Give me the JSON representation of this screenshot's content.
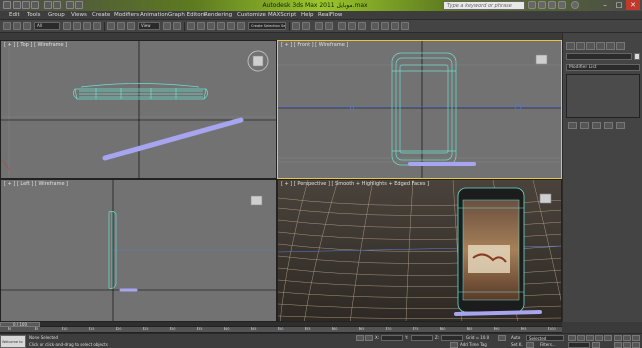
{
  "titlebar": {
    "title": "Autodesk 3ds Max 2011   موبايل.max",
    "search_placeholder": "Type a keyword or phrase",
    "window_controls": [
      "–",
      "□",
      "✕"
    ]
  },
  "menubar": {
    "items": [
      "Edit",
      "Tools",
      "Group",
      "Views",
      "Create",
      "Modifiers",
      "Animation",
      "Graph Editors",
      "Rendering",
      "Customize",
      "MAXScript",
      "Help",
      "RealFlow"
    ]
  },
  "toolbar": {
    "selection_filter": "All",
    "ref_coord": "View",
    "named_selection": "Create Selection Se"
  },
  "viewports": [
    {
      "label": "[ + ] [ Top ] [ Wireframe ]"
    },
    {
      "label": "[ + ] [ Front ] [ Wireframe ]"
    },
    {
      "label": "[ + ] [ Left ] [ Wireframe ]"
    },
    {
      "label": "[ + ] [ Perspective ] [ Smooth + Highlights + Edged Faces ]"
    }
  ],
  "command_panel": {
    "modifier_list_label": "Modifier List"
  },
  "timeline": {
    "frame_readout": "0 / 100",
    "ticks": [
      "0",
      "5",
      "10",
      "15",
      "20",
      "25",
      "30",
      "35",
      "40",
      "45",
      "50",
      "55",
      "60",
      "65",
      "70",
      "75",
      "80",
      "85",
      "90",
      "95",
      "100"
    ]
  },
  "statusbar": {
    "maxscript_label": "Welcome to M",
    "selection_status": "None Selected",
    "prompt": "Click or click-and-drag to select objects",
    "x_label": "X:",
    "y_label": "Y:",
    "z_label": "Z:",
    "grid_readout": "Grid = 10.0",
    "add_time_tag": "Add Time Tag",
    "auto_key": "Auto",
    "set_key": "Set K.",
    "key_mode": "Selected",
    "key_filters": "Filters..."
  },
  "colors": {
    "active_viewport_border": "#e8c53a",
    "wireframe": "#6ee0d0",
    "pen_object": "#a7a4f0",
    "viewport_bg": "#727272"
  }
}
